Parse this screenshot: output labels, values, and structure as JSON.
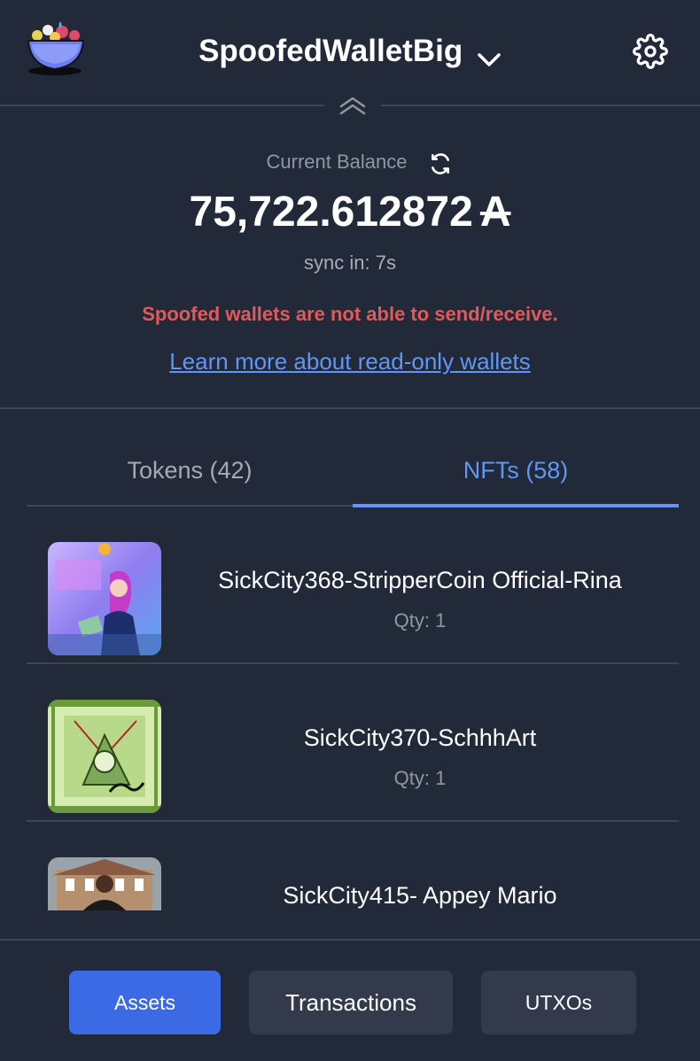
{
  "header": {
    "wallet_name": "SpoofedWalletBig",
    "logo_icon": "fruit-bowl-logo-icon",
    "dropdown_icon": "chevron-down-icon",
    "settings_icon": "gear-icon",
    "collapse_icon": "double-chevron-up-icon"
  },
  "balance": {
    "label": "Current Balance",
    "refresh_icon": "refresh-icon",
    "amount": "75,722.612872",
    "currency_symbol": "A",
    "sync_text": "sync in: 7s"
  },
  "notice": {
    "warning": "Spoofed wallets are not able to send/receive.",
    "link": "Learn more about read-only wallets",
    "warning_color": "#e05a5a",
    "link_color": "#5f97f6"
  },
  "tabs": [
    {
      "label": "Tokens (42)",
      "active": false
    },
    {
      "label": "NFTs (58)",
      "active": true
    }
  ],
  "nfts": [
    {
      "name": "SickCity368-StripperCoin Official-Rina",
      "qty": "Qty: 1"
    },
    {
      "name": "SickCity370-SchhhArt",
      "qty": "Qty: 1"
    },
    {
      "name": "SickCity415- Appey Mario",
      "qty": ""
    }
  ],
  "footer": {
    "buttons": [
      {
        "label": "Assets",
        "active": true
      },
      {
        "label": "Transactions",
        "active": false
      },
      {
        "label": "UTXOs",
        "active": false
      }
    ],
    "active_color": "#3c6ae4"
  }
}
